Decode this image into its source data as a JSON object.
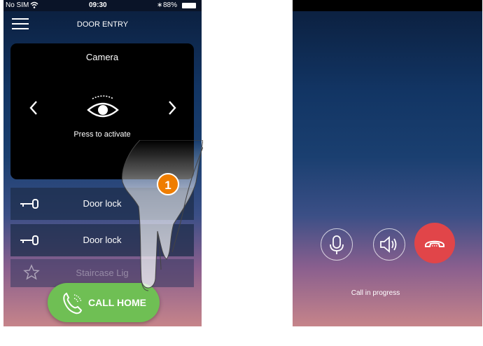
{
  "left_phone": {
    "status_bar": {
      "carrier": "No SIM",
      "time": "09:30",
      "battery": "88%"
    },
    "header": {
      "title": "DOOR ENTRY",
      "menu_icon": "hamburger-menu-icon"
    },
    "camera": {
      "label": "Camera",
      "action_text": "Press to activate"
    },
    "door_locks": [
      {
        "label": "Door lock"
      },
      {
        "label": "Door lock"
      }
    ],
    "staircase": {
      "label": "Staircase Lig"
    },
    "call_home": {
      "label": "CALL HOME"
    },
    "callout_badge": "1"
  },
  "right_phone": {
    "call_status": "Call in progress",
    "buttons": [
      "microphone-icon",
      "speaker-icon",
      "hang-up-icon"
    ]
  },
  "colors": {
    "call_home_green": "#6fbf54",
    "hang_up_red": "#e14549",
    "badge_orange": "#ef7d00"
  }
}
